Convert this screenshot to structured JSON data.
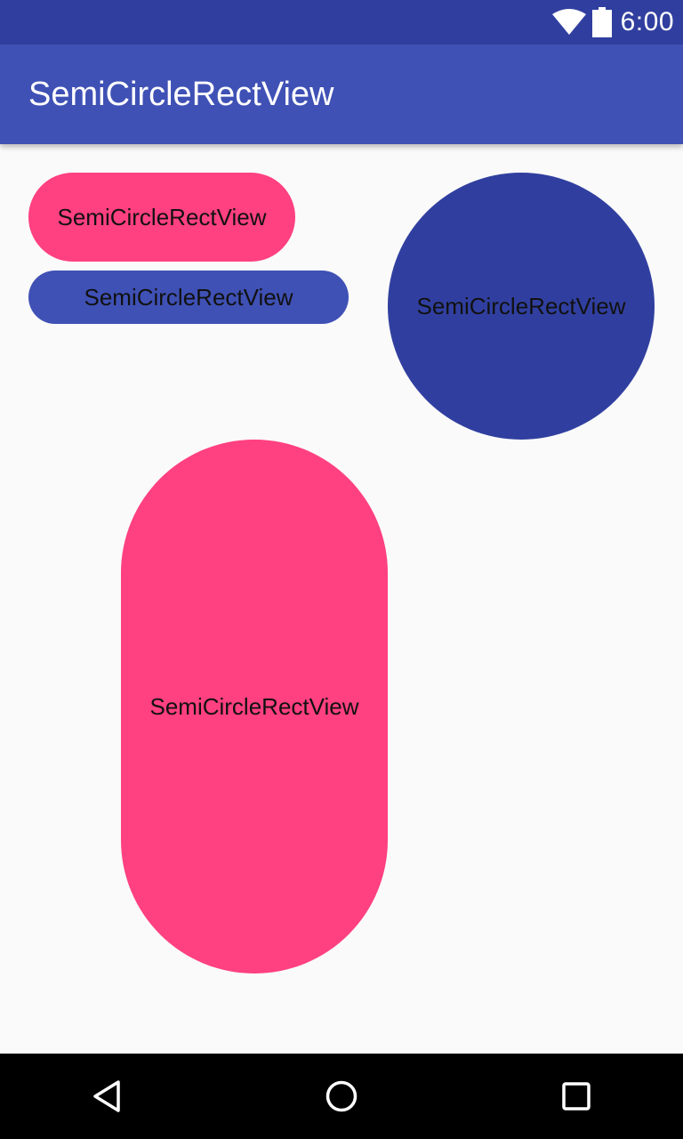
{
  "status_bar": {
    "time": "6:00",
    "icons": [
      "wifi-icon",
      "battery-icon"
    ]
  },
  "app_bar": {
    "title": "SemiCircleRectView"
  },
  "views": {
    "pink_top_label": "SemiCircleRectView",
    "indigo_label": "SemiCircleRectView",
    "circle_label": "SemiCircleRectView",
    "pink_tall_label": "SemiCircleRectView"
  },
  "nav_bar": {
    "icons": [
      "back-icon",
      "home-icon",
      "recents-icon"
    ]
  },
  "colors": {
    "status_bar": "#303f9f",
    "app_bar": "#3f51b5",
    "accent_pink": "#ff4081",
    "indigo": "#3f51b5",
    "dark_indigo": "#303f9f",
    "background": "#fafafa"
  }
}
